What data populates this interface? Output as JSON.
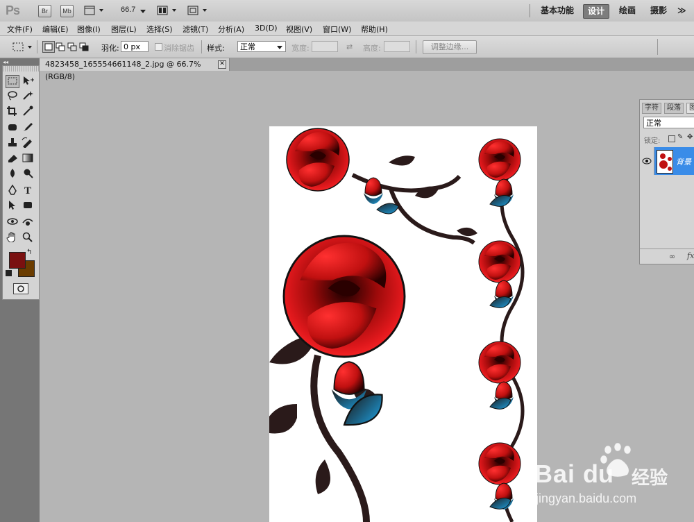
{
  "app": {
    "logo": "Ps",
    "bridge_label": "Br",
    "mini_bridge_label": "Mb",
    "zoom_value": "66.7",
    "workspaces": [
      "基本功能",
      "设计",
      "绘画",
      "摄影"
    ],
    "active_workspace": "设计",
    "more": "≫"
  },
  "menu": [
    "文件(F)",
    "编辑(E)",
    "图像(I)",
    "图层(L)",
    "选择(S)",
    "滤镜(T)",
    "分析(A)",
    "3D(D)",
    "视图(V)",
    "窗口(W)",
    "帮助(H)"
  ],
  "options": {
    "feather_label": "羽化:",
    "feather_value": "0 px",
    "antialias_label": "消除锯齿",
    "style_label": "样式:",
    "style_value": "正常",
    "width_label": "宽度:",
    "height_label": "高度:",
    "refine_edge_label": "调整边缘..."
  },
  "document": {
    "tab_title": "4823458_165554661148_2.jpg @ 66.7%(RGB/8)",
    "close": "✕"
  },
  "colors": {
    "foreground": "#7a1010",
    "background": "#6a3c00",
    "active_layer": "#3a8ce8"
  },
  "layers_panel": {
    "tabs": [
      "字符",
      "段落",
      "图"
    ],
    "blend_mode": "正常",
    "lock_label": "锁定:",
    "layer_name": "背景"
  },
  "watermark": {
    "brand": "Bai",
    "brand2": "du",
    "cn": "经验",
    "url": "jingyan.baidu.com"
  }
}
